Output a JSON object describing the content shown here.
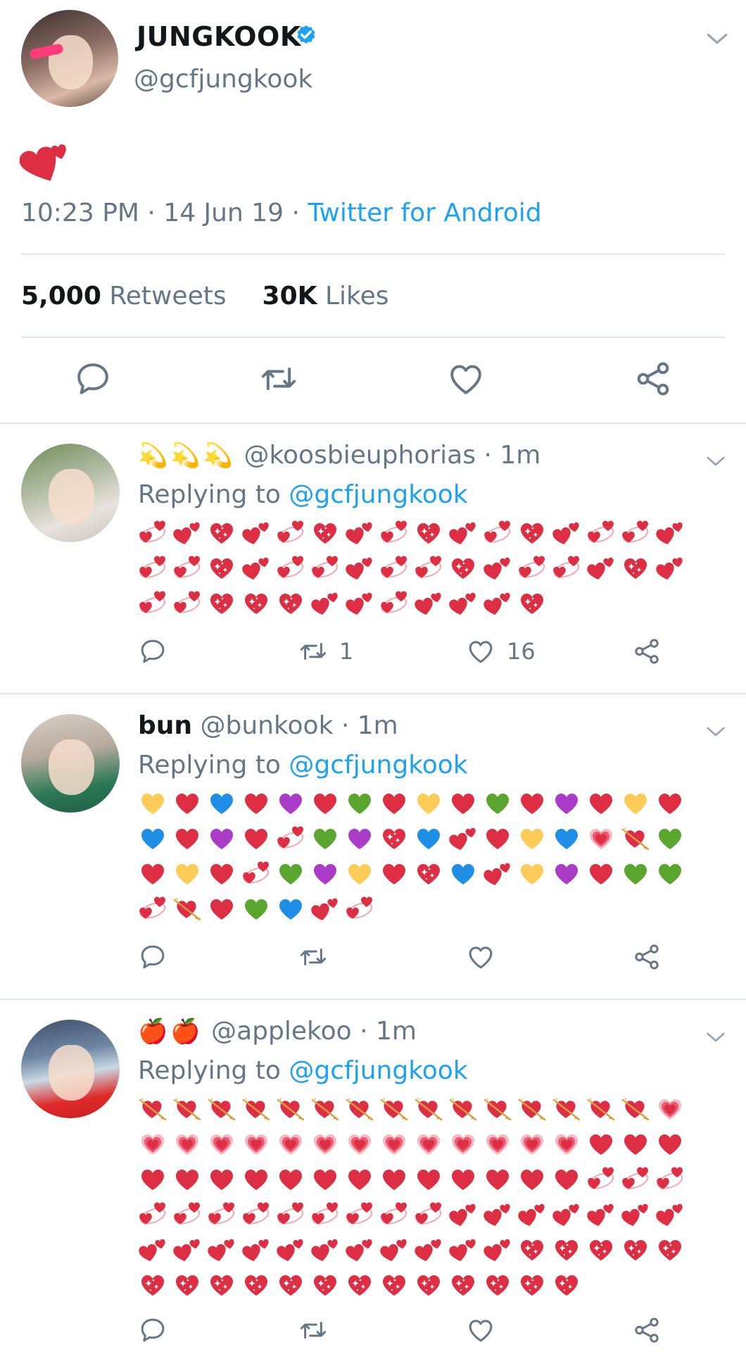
{
  "main_tweet": {
    "name": "JUNGKOOK",
    "handle": "@gcfjungkook",
    "content_emoji": "two-hearts",
    "time": "10:23 PM · 14 Jun 19 · ",
    "source": "Twitter for Android",
    "retweets_count": "5,000",
    "retweets_label": "Retweets",
    "likes_count": "30K",
    "likes_label": "Likes"
  },
  "replies": [
    {
      "name": "",
      "display_emoji": "💫💫💫",
      "handle": "@koosbieuphorias",
      "time": "· 1m",
      "replying_prefix": "Replying to ",
      "replying_handle": "@gcfjungkook",
      "emojis": [
        "revolving",
        "two",
        "sparkle",
        "two",
        "revolving",
        "sparkle",
        "two",
        "revolving",
        "sparkle",
        "two",
        "revolving",
        "sparkle",
        "two",
        "revolving",
        "revolving",
        "two",
        "revolving",
        "revolving",
        "sparkle",
        "two",
        "revolving",
        "revolving",
        "two",
        "revolving",
        "revolving",
        "sparkle",
        "two",
        "revolving",
        "revolving",
        "two",
        "sparkle",
        "two",
        "revolving",
        "revolving",
        "sparkle",
        "sparkle",
        "sparkle",
        "two",
        "two",
        "revolving",
        "two",
        "two",
        "two",
        "sparkle"
      ],
      "retweet_count": "1",
      "like_count": "16"
    },
    {
      "name": "bun",
      "display_emoji": "",
      "handle": "@bunkook",
      "time": "· 1m",
      "replying_prefix": "Replying to ",
      "replying_handle": "@gcfjungkook",
      "emojis": [
        "yellow",
        "red",
        "blue",
        "red",
        "purple",
        "red",
        "green",
        "red",
        "yellow",
        "red",
        "green",
        "red",
        "purple",
        "red",
        "yellow",
        "red",
        "blue",
        "red",
        "purple",
        "red",
        "revolving",
        "green",
        "purple",
        "sparkle",
        "blue",
        "two",
        "red",
        "yellow",
        "blue",
        "growing",
        "arrow",
        "green",
        "red",
        "yellow",
        "red",
        "revolving",
        "green",
        "purple",
        "yellow",
        "red",
        "sparkle",
        "blue",
        "two",
        "yellow",
        "purple",
        "red",
        "green",
        "green",
        "revolving",
        "arrow",
        "red",
        "green",
        "blue",
        "two",
        "revolving"
      ],
      "retweet_count": "",
      "like_count": ""
    },
    {
      "name": "",
      "display_emoji": "🍎🍎",
      "handle": "@applekoo",
      "time": "· 1m",
      "replying_prefix": "Replying to ",
      "replying_handle": "@gcfjungkook",
      "emojis": [
        "arrow",
        "arrow",
        "arrow",
        "arrow",
        "arrow",
        "arrow",
        "arrow",
        "arrow",
        "arrow",
        "arrow",
        "arrow",
        "arrow",
        "arrow",
        "arrow",
        "arrow",
        "growing",
        "growing",
        "growing",
        "growing",
        "growing",
        "growing",
        "growing",
        "growing",
        "growing",
        "growing",
        "growing",
        "growing",
        "growing",
        "growing",
        "red",
        "red",
        "red",
        "red",
        "red",
        "red",
        "red",
        "red",
        "red",
        "red",
        "red",
        "red",
        "red",
        "red",
        "red",
        "red",
        "revolving",
        "revolving",
        "revolving",
        "revolving",
        "revolving",
        "revolving",
        "revolving",
        "revolving",
        "revolving",
        "revolving",
        "revolving",
        "revolving",
        "two",
        "two",
        "two",
        "two",
        "two",
        "two",
        "two",
        "two",
        "two",
        "two",
        "two",
        "two",
        "two",
        "two",
        "two",
        "two",
        "two",
        "two",
        "sparkle",
        "sparkle",
        "sparkle",
        "sparkle",
        "sparkle",
        "sparkle",
        "sparkle",
        "sparkle",
        "sparkle",
        "sparkle",
        "sparkle",
        "sparkle",
        "sparkle",
        "sparkle",
        "sparkle",
        "sparkle",
        "sparkle",
        "sparkle"
      ],
      "retweet_count": "",
      "like_count": ""
    }
  ],
  "colors": {
    "link": "#1da1f2",
    "muted": "#657786",
    "divider": "#e1e8ed",
    "heart_red": "#dd2e44",
    "heart_yellow": "#fdcb58",
    "heart_blue": "#1e8ee6",
    "heart_purple": "#aa3cc8",
    "heart_green": "#5aa52d"
  },
  "icons": [
    "verified-badge-icon",
    "chevron-down-icon",
    "reply-icon",
    "retweet-icon",
    "like-icon",
    "share-icon"
  ]
}
